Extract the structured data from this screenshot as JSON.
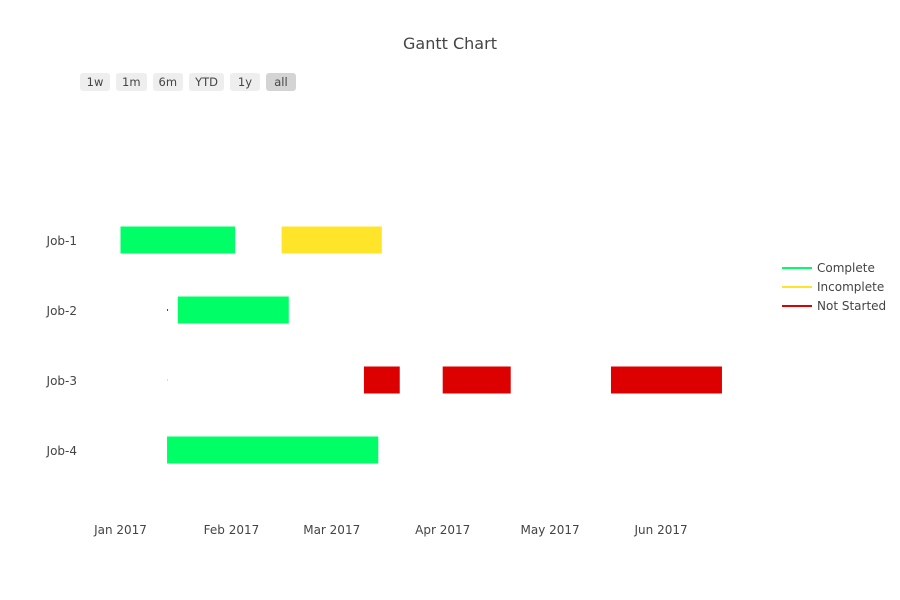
{
  "chart_data": {
    "type": "gantt",
    "title": "Gantt Chart",
    "xlabel": "",
    "ylabel": "",
    "x_axis": {
      "type": "date",
      "range": [
        "2017-01-01",
        "2017-07-01"
      ],
      "ticks": [
        {
          "date": "2017-01-01",
          "label": "Jan 2017"
        },
        {
          "date": "2017-02-01",
          "label": "Feb 2017"
        },
        {
          "date": "2017-03-01",
          "label": "Mar 2017"
        },
        {
          "date": "2017-04-01",
          "label": "Apr 2017"
        },
        {
          "date": "2017-05-01",
          "label": "May 2017"
        },
        {
          "date": "2017-06-01",
          "label": "Jun 2017"
        }
      ]
    },
    "categories": [
      "Job-1",
      "Job-2",
      "Job-3",
      "Job-4"
    ],
    "grid": false,
    "legend_position": "right",
    "legend": [
      {
        "name": "Complete",
        "color": "#00ff66"
      },
      {
        "name": "Incomplete",
        "color": "#ffe52a"
      },
      {
        "name": "Not Started",
        "color": "#dd0000"
      }
    ],
    "tasks": [
      {
        "task": "Job-1",
        "start": "2017-01-01",
        "finish": "2017-02-02",
        "resource": "Complete"
      },
      {
        "task": "Job-1",
        "start": "2017-02-15",
        "finish": "2017-03-15",
        "resource": "Incomplete"
      },
      {
        "task": "Job-2",
        "start": "2017-01-14",
        "finish": "2017-01-14",
        "resource": "Not Started"
      },
      {
        "task": "Job-2",
        "start": "2017-01-17",
        "finish": "2017-02-17",
        "resource": "Complete"
      },
      {
        "task": "Job-3",
        "start": "2017-01-14",
        "finish": "2017-01-14",
        "resource": "Incomplete"
      },
      {
        "task": "Job-3",
        "start": "2017-03-10",
        "finish": "2017-03-20",
        "resource": "Not Started"
      },
      {
        "task": "Job-3",
        "start": "2017-04-01",
        "finish": "2017-04-20",
        "resource": "Not Started"
      },
      {
        "task": "Job-3",
        "start": "2017-05-18",
        "finish": "2017-06-18",
        "resource": "Not Started"
      },
      {
        "task": "Job-4",
        "start": "2017-01-14",
        "finish": "2017-03-14",
        "resource": "Complete"
      }
    ]
  },
  "range_selector": {
    "buttons": [
      {
        "label": "1w",
        "active": false
      },
      {
        "label": "1m",
        "active": false
      },
      {
        "label": "6m",
        "active": false
      },
      {
        "label": "YTD",
        "active": false
      },
      {
        "label": "1y",
        "active": false
      },
      {
        "label": "all",
        "active": true
      }
    ]
  }
}
